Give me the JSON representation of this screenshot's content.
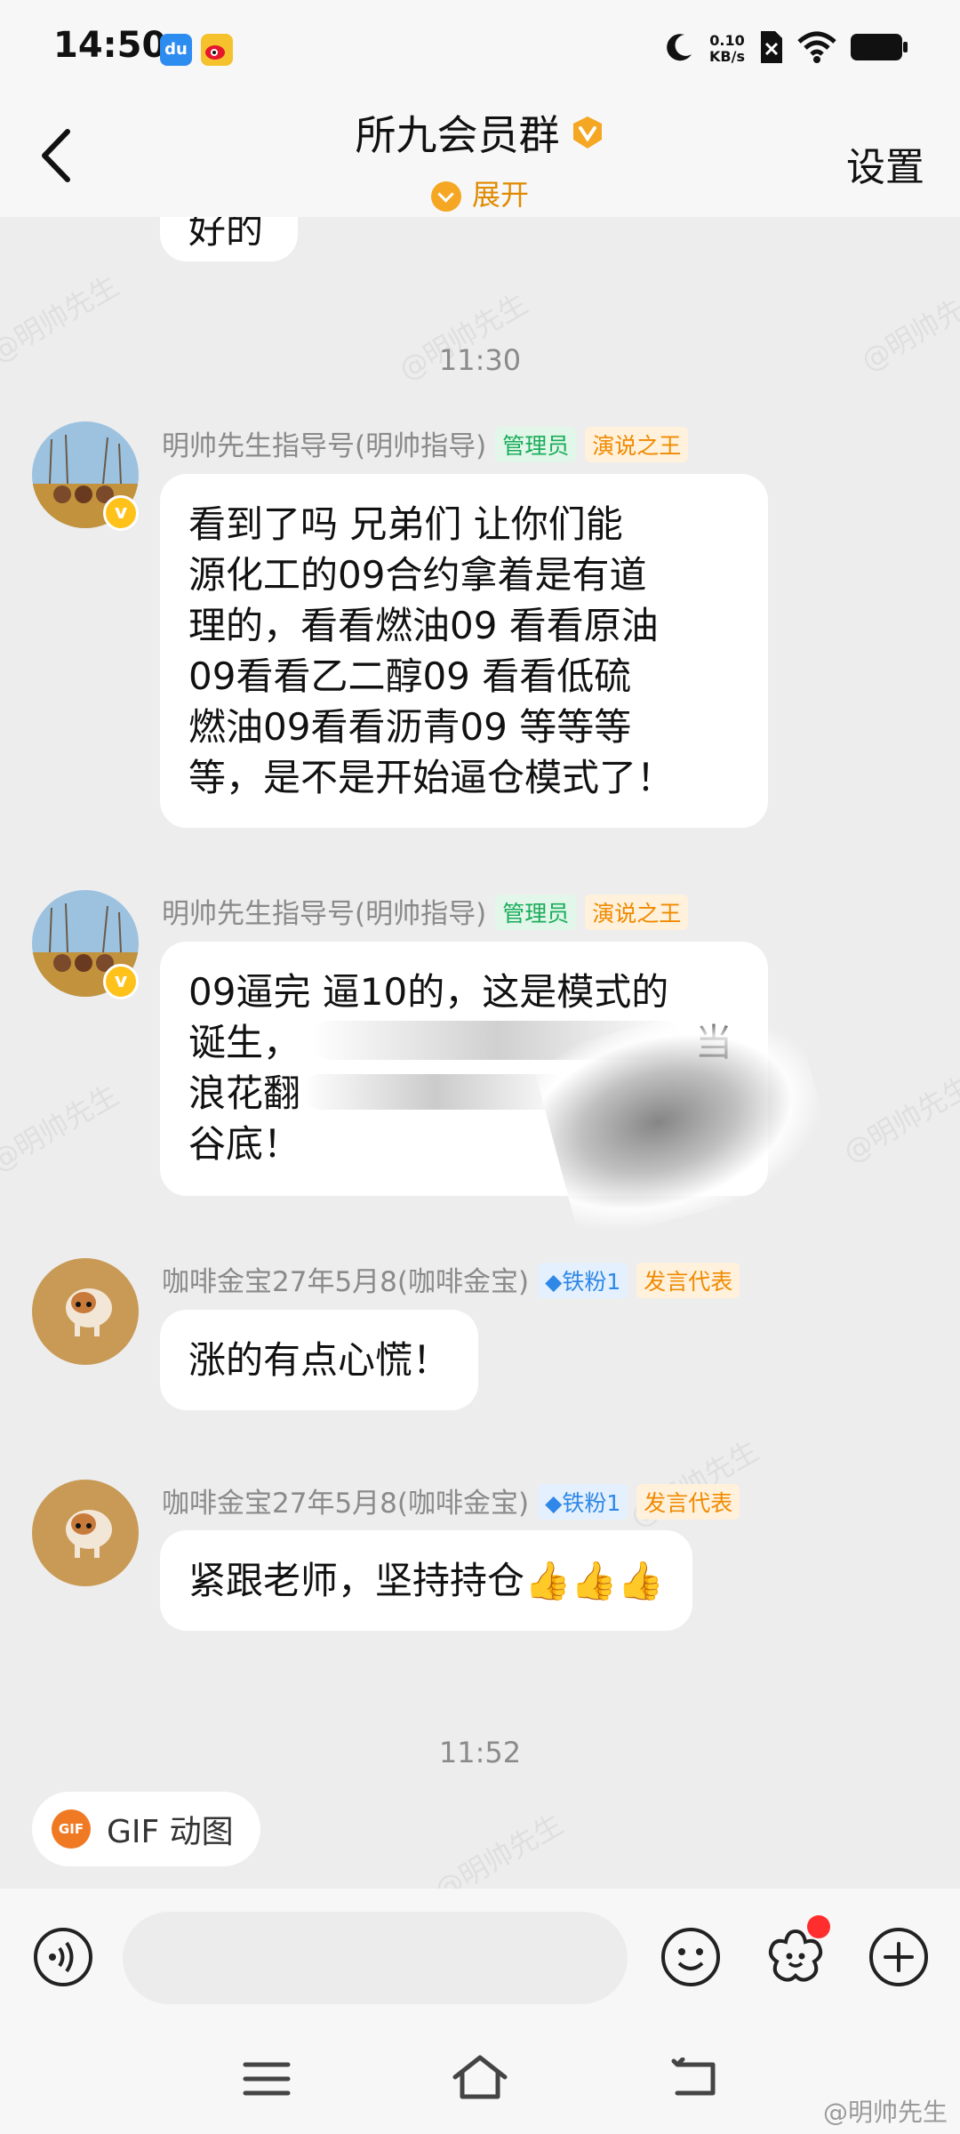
{
  "status_bar": {
    "time": "14:50",
    "app1_label": "du",
    "net_speed_value": "0.10",
    "net_speed_unit": "KB/s"
  },
  "header": {
    "title": "所九会员群",
    "expand_label": "展开",
    "settings_label": "设置"
  },
  "chat": {
    "partial_top_text": "好的",
    "timestamp1": "11:30",
    "messages": [
      {
        "sender": "明帅先生指导号(明帅指导)",
        "tags": [
          "管理员",
          "演说之王"
        ],
        "lines": [
          "看到了吗  兄弟们  让你们能",
          "源化工的09合约拿着是有道",
          "理的，看看燃油09  看看原油",
          "09看看乙二醇09   看看低硫",
          "燃油09看看沥青09  等等等",
          "等，是不是开始逼仓模式了！"
        ]
      },
      {
        "sender": "明帅先生指导号(明帅指导)",
        "tags": [
          "管理员",
          "演说之王"
        ],
        "lines": [
          "09逼完  逼10的，这是模式的",
          "诞生，",
          "浪花翻",
          "谷底！"
        ],
        "line2_tail": "当"
      },
      {
        "sender": "咖啡金宝27年5月8(咖啡金宝)",
        "tags": [
          "铁粉1",
          "发言代表"
        ],
        "lines": [
          "涨的有点心慌！"
        ]
      },
      {
        "sender": "咖啡金宝27年5月8(咖啡金宝)",
        "tags": [
          "铁粉1",
          "发言代表"
        ],
        "lines": [
          "紧跟老师，坚持持仓👍👍👍"
        ]
      }
    ],
    "timestamp2": "11:52",
    "gif_label": "GIF 动图",
    "gif_icon_text": "GIF",
    "watermark": "@明帅先生"
  },
  "bottom": {
    "weibo_watermark": "@明帅先生"
  }
}
